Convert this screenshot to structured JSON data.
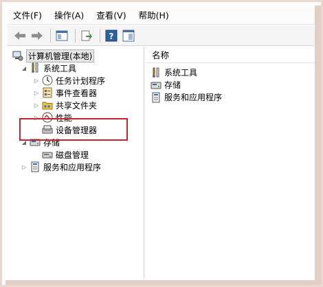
{
  "menubar": {
    "items": [
      "文件(F)",
      "操作(A)",
      "查看(V)",
      "帮助(H)"
    ]
  },
  "toolbar": {
    "buttons": [
      "back-icon",
      "forward-icon",
      "show-hide-tree-icon",
      "export-list-icon",
      "help-icon",
      "properties-icon"
    ]
  },
  "tree": {
    "root": "计算机管理(本地)",
    "system_tools": "系统工具",
    "task_scheduler": "任务计划程序",
    "event_viewer": "事件查看器",
    "shared_folders": "共享文件夹",
    "performance": "性能",
    "device_manager": "设备管理器",
    "storage": "存储",
    "disk_management": "磁盘管理",
    "services_apps": "服务和应用程序"
  },
  "content": {
    "column_header": "名称",
    "items": [
      "系统工具",
      "存储",
      "服务和应用程序"
    ]
  },
  "colors": {
    "highlight_border": "#c4232b",
    "expander": "#6b6b6b"
  }
}
